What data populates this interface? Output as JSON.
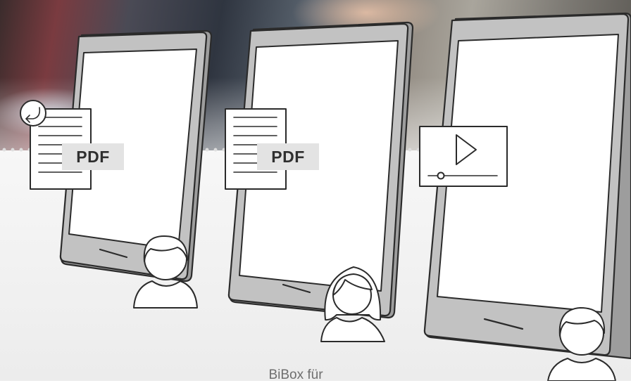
{
  "documents": [
    {
      "label": "PDF",
      "badge": "return-arrow-icon"
    },
    {
      "label": "PDF"
    }
  ],
  "video": {
    "icon": "play-icon"
  },
  "caption": "BiBox für",
  "colors": {
    "tablet_frame": "#c2c2c2",
    "outline": "#2b2b2b",
    "pdf_label_bg": "#e3e3e3",
    "caption_text": "#6e6e6e"
  }
}
